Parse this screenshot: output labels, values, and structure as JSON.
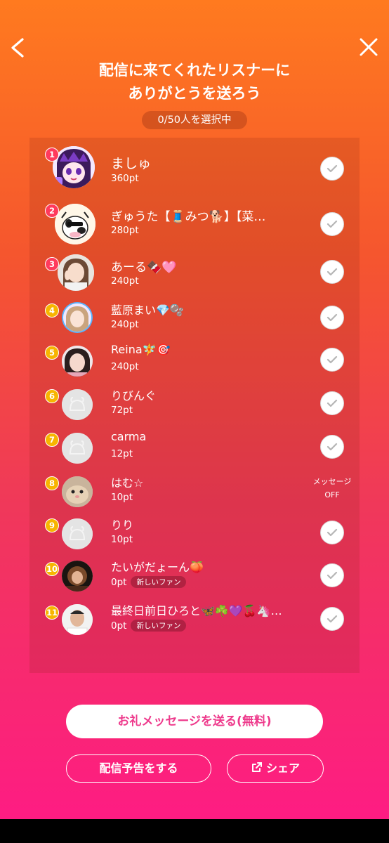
{
  "header": {
    "title_line1": "配信に来てくれたリスナーに",
    "title_line2": "ありがとうを送ろう",
    "selected_count": "0/50人を選択中"
  },
  "listeners": [
    {
      "rank": "1",
      "name": "ましゅ",
      "points": "360pt",
      "status": "checked"
    },
    {
      "rank": "2",
      "name": "ぎゅうた【🧵みつ🐕】【菜…",
      "points": "280pt",
      "status": "checked"
    },
    {
      "rank": "3",
      "name": "あーる🍫🩷",
      "points": "240pt",
      "status": "checked"
    },
    {
      "rank": "4",
      "name": "藍原まい💎🫧",
      "points": "240pt",
      "status": "checked"
    },
    {
      "rank": "5",
      "name": "Reina🧚🎯",
      "points": "240pt",
      "status": "checked"
    },
    {
      "rank": "6",
      "name": "りびんぐ",
      "points": "72pt",
      "status": "checked"
    },
    {
      "rank": "7",
      "name": "carma",
      "points": "12pt",
      "status": "checked"
    },
    {
      "rank": "8",
      "name": "はむ☆",
      "points": "10pt",
      "status": "message_off",
      "status_line1": "メッセージ",
      "status_line2": "OFF"
    },
    {
      "rank": "9",
      "name": "りり",
      "points": "10pt",
      "status": "checked"
    },
    {
      "rank": "10",
      "name": "たいがだょーん🍑",
      "points": "0pt",
      "badge": "新しいファン",
      "status": "checked"
    },
    {
      "rank": "11",
      "name": "最終日前日ひろと🦋☘️💜🍒🦄…",
      "points": "0pt",
      "badge": "新しいファン",
      "status": "checked"
    }
  ],
  "actions": {
    "thanks_button": "お礼メッセージを送る(無料)",
    "announce_button": "配信予告をする",
    "share_button": "シェア"
  },
  "icons": {
    "back": "chevron-left-icon",
    "close": "close-icon",
    "check": "checkmark-icon",
    "share": "share-icon"
  },
  "colors": {
    "gradient_top": "#ff7a1f",
    "gradient_bottom": "#ff1a86",
    "rank_top3": "#ff3a5c",
    "rank_other": "#f7b500",
    "primary_text": "#ee3a8c"
  }
}
